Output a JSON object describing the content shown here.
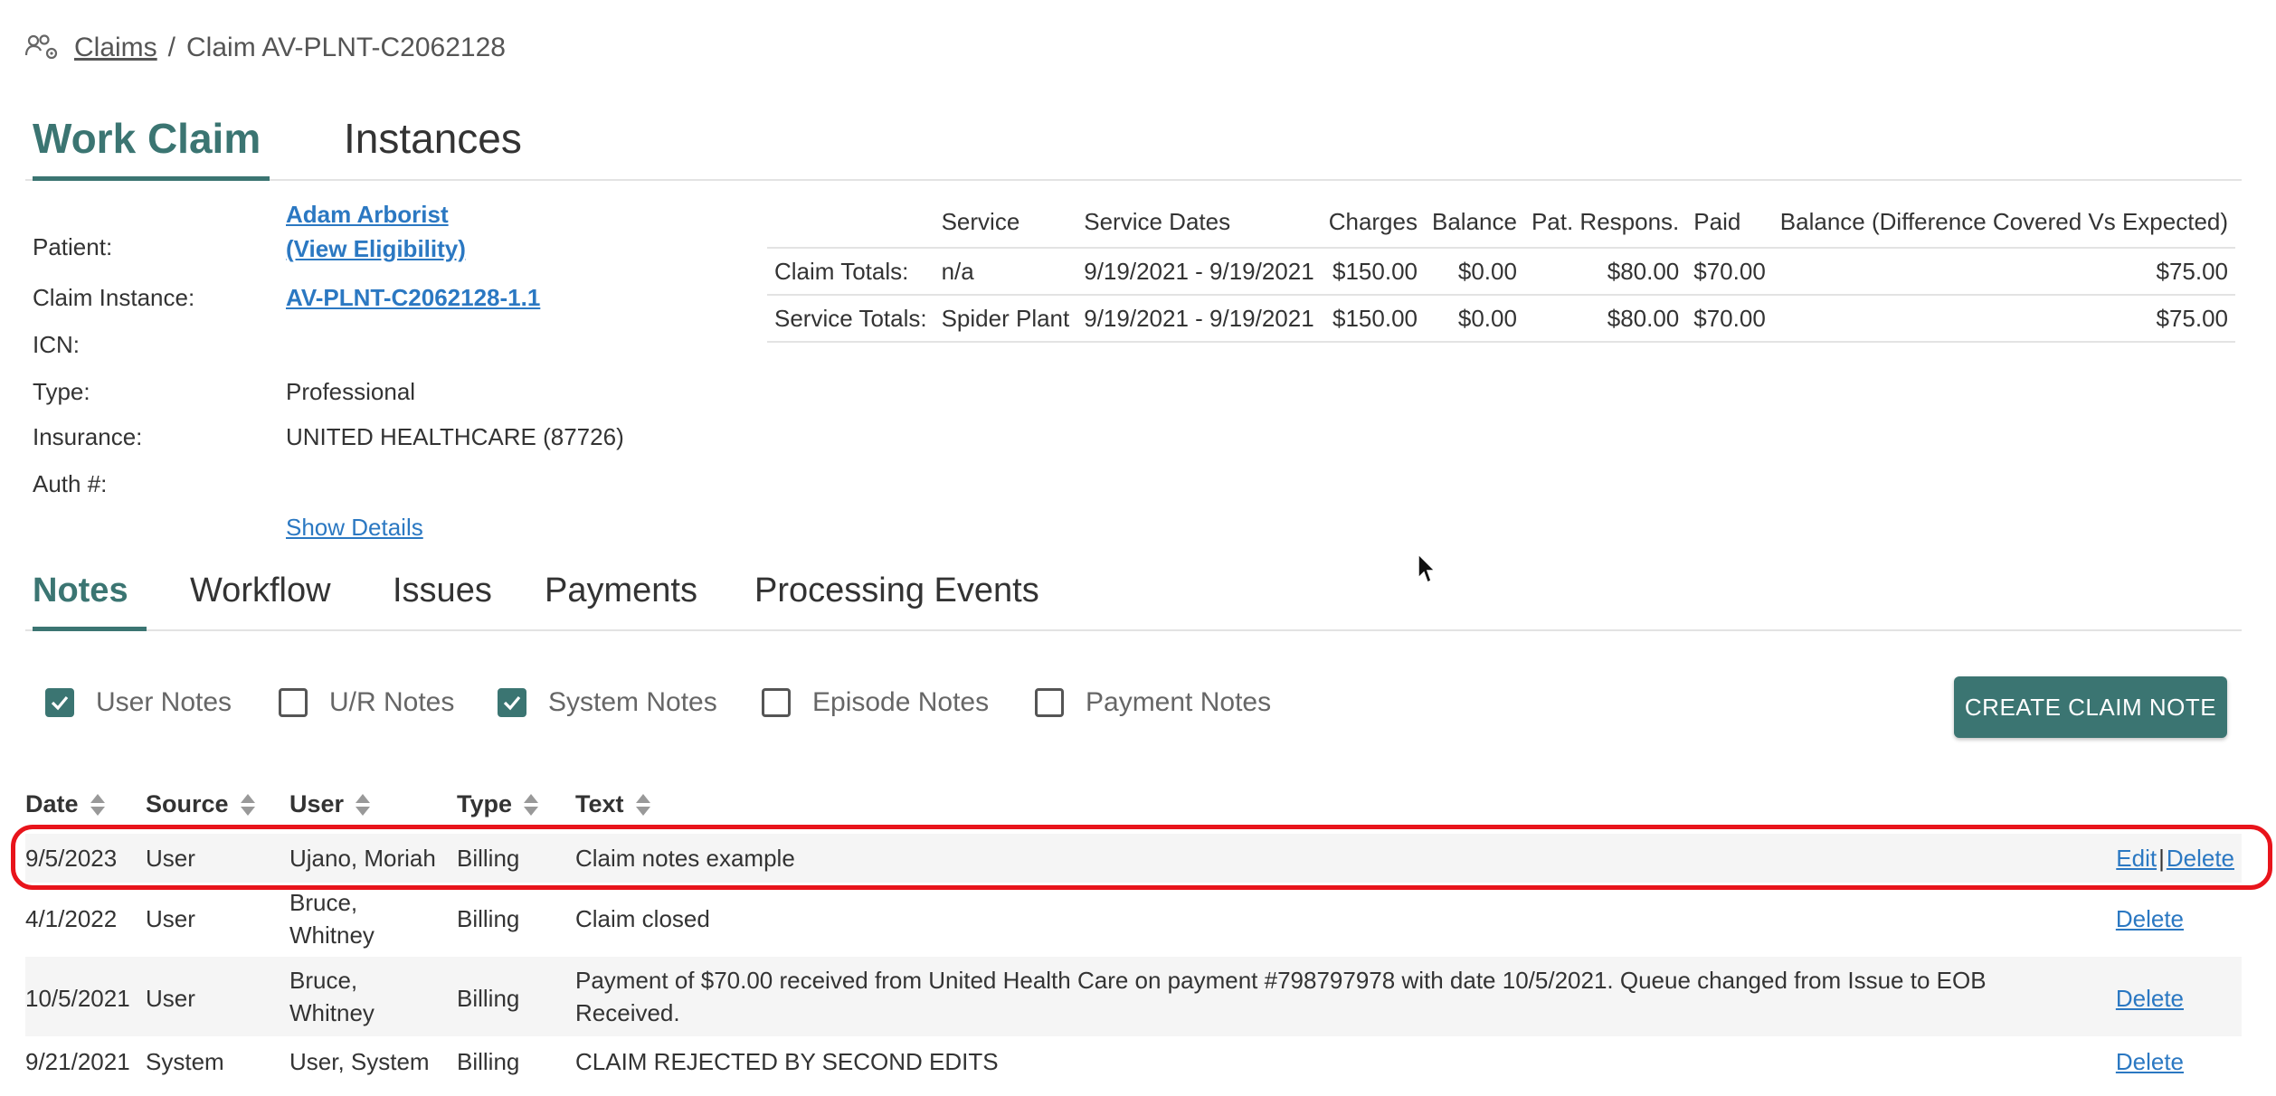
{
  "breadcrumb": {
    "icon": "people-settings-icon",
    "link": "Claims",
    "separator": "/",
    "current": "Claim AV-PLNT-C2062128"
  },
  "top_tabs": [
    {
      "label": "Work Claim",
      "active": true
    },
    {
      "label": "Instances",
      "active": false
    }
  ],
  "claim_info": {
    "patient_label": "Patient:",
    "patient_name": "Adam Arborist",
    "view_eligibility": "(View Eligibility)",
    "instance_label": "Claim Instance:",
    "instance_value": "AV-PLNT-C2062128-1.1",
    "icn_label": "ICN:",
    "icn_value": "",
    "type_label": "Type:",
    "type_value": "Professional",
    "insurance_label": "Insurance:",
    "insurance_value": "UNITED HEALTHCARE (87726)",
    "auth_label": "Auth #:",
    "auth_value": "",
    "show_details": "Show Details"
  },
  "totals": {
    "headers": [
      "",
      "Service",
      "Service Dates",
      "Charges",
      "Balance",
      "Pat. Respons.",
      "Paid",
      "Balance (Difference Covered Vs Expected)"
    ],
    "rows": [
      [
        "Claim Totals:",
        "n/a",
        "9/19/2021 - 9/19/2021",
        "$150.00",
        "$0.00",
        "$80.00",
        "$70.00",
        "$75.00"
      ],
      [
        "Service Totals:",
        "Spider Plant",
        "9/19/2021 - 9/19/2021",
        "$150.00",
        "$0.00",
        "$80.00",
        "$70.00",
        "$75.00"
      ]
    ]
  },
  "sub_tabs": [
    {
      "label": "Notes",
      "active": true
    },
    {
      "label": "Workflow",
      "active": false
    },
    {
      "label": "Issues",
      "active": false
    },
    {
      "label": "Payments",
      "active": false
    },
    {
      "label": "Processing Events",
      "active": false
    }
  ],
  "filters": [
    {
      "label": "User Notes",
      "checked": true
    },
    {
      "label": "U/R Notes",
      "checked": false
    },
    {
      "label": "System Notes",
      "checked": true
    },
    {
      "label": "Episode Notes",
      "checked": false
    },
    {
      "label": "Payment Notes",
      "checked": false
    }
  ],
  "create_button": "CREATE CLAIM NOTE",
  "notes": {
    "headers": [
      "Date",
      "Source",
      "User",
      "Type",
      "Text"
    ],
    "rows": [
      {
        "date": "9/5/2023",
        "source": "User",
        "user": "Ujano, Moriah",
        "type": "Billing",
        "text": "Claim notes example",
        "edit": "Edit",
        "delete": "Delete"
      },
      {
        "date": "4/1/2022",
        "source": "User",
        "user": "Bruce, Whitney",
        "type": "Billing",
        "text": "Claim closed",
        "edit": "",
        "delete": "Delete"
      },
      {
        "date": "10/5/2021",
        "source": "User",
        "user": "Bruce, Whitney",
        "type": "Billing",
        "text": "Payment of $70.00 received from United Health Care on payment #798797978 with date 10/5/2021. Queue changed from Issue to EOB Received.",
        "edit": "",
        "delete": "Delete"
      },
      {
        "date": "9/21/2021",
        "source": "System",
        "user": "User, System",
        "type": "Billing",
        "text": "CLAIM REJECTED BY SECOND EDITS",
        "edit": "",
        "delete": "Delete"
      }
    ]
  },
  "colors": {
    "accent": "#3b7572",
    "link": "#2b78c2",
    "highlight": "#e8141b"
  }
}
